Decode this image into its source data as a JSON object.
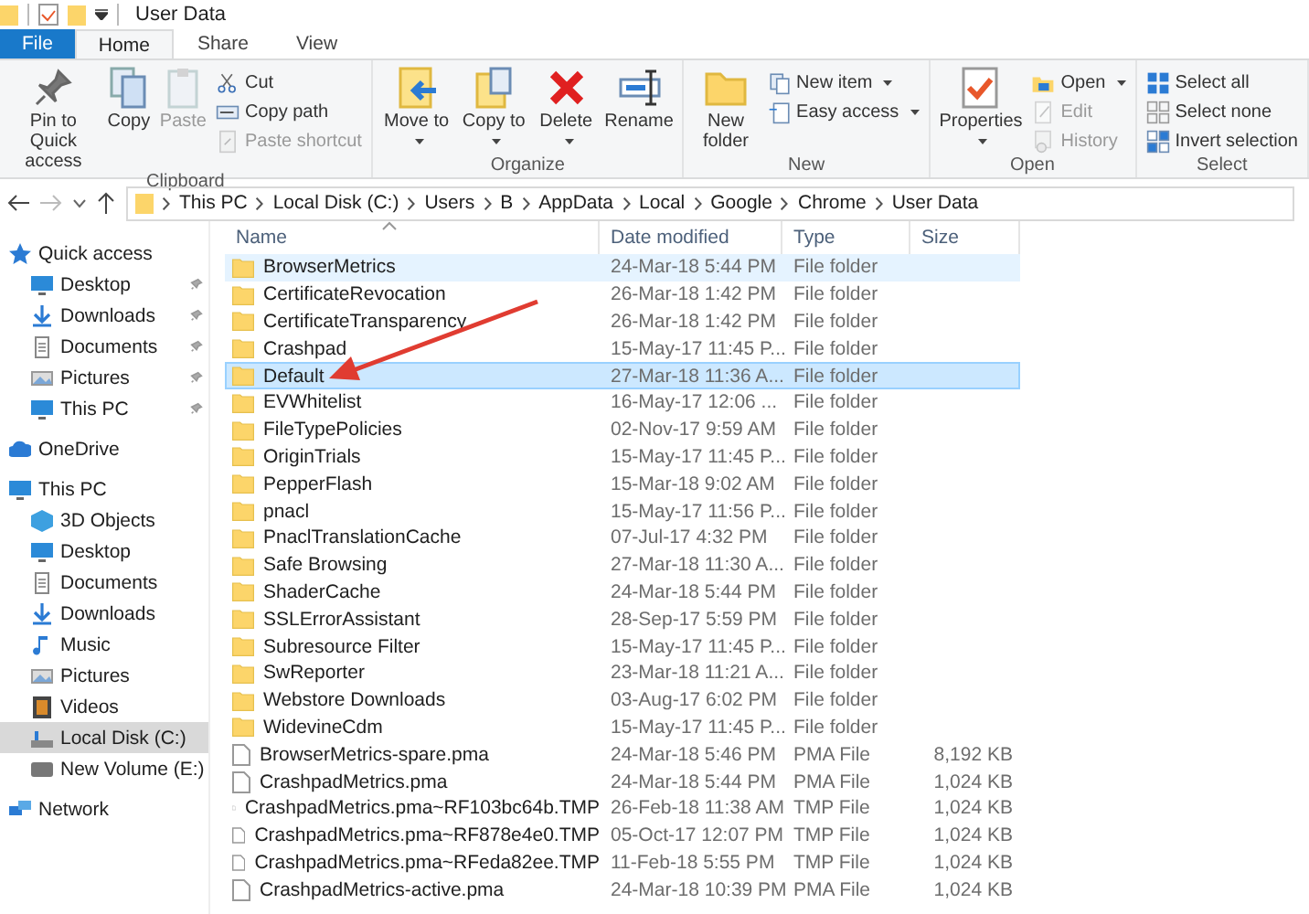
{
  "window": {
    "title": "User Data"
  },
  "tabs": [
    {
      "label": "File",
      "kind": "file",
      "selected": false
    },
    {
      "label": "Home",
      "kind": "tab",
      "selected": true
    },
    {
      "label": "Share",
      "kind": "tab",
      "selected": false
    },
    {
      "label": "View",
      "kind": "tab",
      "selected": false
    }
  ],
  "ribbon": [
    {
      "name": "Clipboard",
      "large": [
        {
          "label": "Pin to Quick access",
          "kind": "pin",
          "disabled": false,
          "dropdown": false
        },
        {
          "label": "Copy",
          "kind": "copy",
          "disabled": false,
          "dropdown": false
        },
        {
          "label": "Paste",
          "kind": "paste",
          "disabled": true,
          "dropdown": false
        }
      ],
      "small": [
        {
          "label": "Cut",
          "kind": "cut",
          "disabled": false,
          "dropdown": false
        },
        {
          "label": "Copy path",
          "kind": "path",
          "disabled": false,
          "dropdown": false
        },
        {
          "label": "Paste shortcut",
          "kind": "shortcut",
          "disabled": true,
          "dropdown": false
        }
      ]
    },
    {
      "name": "Organize",
      "large": [
        {
          "label": "Move to",
          "kind": "move",
          "disabled": false,
          "dropdown": true
        },
        {
          "label": "Copy to",
          "kind": "copyto",
          "disabled": false,
          "dropdown": true
        },
        {
          "label": "Delete",
          "kind": "delete",
          "disabled": false,
          "dropdown": true
        },
        {
          "label": "Rename",
          "kind": "rename",
          "disabled": false,
          "dropdown": false
        }
      ]
    },
    {
      "name": "New",
      "large": [
        {
          "label": "New folder",
          "kind": "folder",
          "disabled": false,
          "dropdown": false
        }
      ],
      "small": [
        {
          "label": "New item",
          "kind": "newitem",
          "disabled": false,
          "dropdown": true
        },
        {
          "label": "Easy access",
          "kind": "easy",
          "disabled": false,
          "dropdown": true
        }
      ]
    },
    {
      "name": "Open",
      "large": [
        {
          "label": "Properties",
          "kind": "props",
          "disabled": false,
          "dropdown": true
        }
      ],
      "small": [
        {
          "label": "Open",
          "kind": "open",
          "disabled": false,
          "dropdown": true
        },
        {
          "label": "Edit",
          "kind": "edit",
          "disabled": true,
          "dropdown": false
        },
        {
          "label": "History",
          "kind": "history",
          "disabled": true,
          "dropdown": false
        }
      ]
    },
    {
      "name": "Select",
      "small": [
        {
          "label": "Select all",
          "kind": "selall",
          "disabled": false,
          "dropdown": false
        },
        {
          "label": "Select none",
          "kind": "selnone",
          "disabled": false,
          "dropdown": false
        },
        {
          "label": "Invert selection",
          "kind": "invert",
          "disabled": false,
          "dropdown": false
        }
      ]
    }
  ],
  "address": {
    "path": [
      "This PC",
      "Local Disk (C:)",
      "Users",
      "B",
      "AppData",
      "Local",
      "Google",
      "Chrome",
      "User Data"
    ]
  },
  "sidebar": {
    "items": [
      {
        "label": "Quick access",
        "kind": "star",
        "selected": false,
        "children": [
          {
            "label": "Desktop",
            "kind": "desktop",
            "pinned": true,
            "selected": false
          },
          {
            "label": "Downloads",
            "kind": "download",
            "pinned": true,
            "selected": false
          },
          {
            "label": "Documents",
            "kind": "document",
            "pinned": true,
            "selected": false
          },
          {
            "label": "Pictures",
            "kind": "picture",
            "pinned": true,
            "selected": false
          },
          {
            "label": "This PC",
            "kind": "desktop",
            "pinned": true,
            "selected": false
          }
        ]
      },
      {
        "label": "OneDrive",
        "kind": "cloud",
        "selected": false
      },
      {
        "label": "This PC",
        "kind": "desktop",
        "selected": false,
        "children": [
          {
            "label": "3D Objects",
            "kind": "cube",
            "pinned": false,
            "selected": false
          },
          {
            "label": "Desktop",
            "kind": "desktop",
            "pinned": false,
            "selected": false
          },
          {
            "label": "Documents",
            "kind": "document",
            "pinned": false,
            "selected": false
          },
          {
            "label": "Downloads",
            "kind": "download",
            "pinned": false,
            "selected": false
          },
          {
            "label": "Music",
            "kind": "music",
            "pinned": false,
            "selected": false
          },
          {
            "label": "Pictures",
            "kind": "picture",
            "pinned": false,
            "selected": false
          },
          {
            "label": "Videos",
            "kind": "video",
            "pinned": false,
            "selected": false
          },
          {
            "label": "Local Disk (C:)",
            "kind": "disk",
            "pinned": false,
            "selected": true
          },
          {
            "label": "New Volume (E:)",
            "kind": "drive",
            "pinned": false,
            "selected": false
          }
        ]
      },
      {
        "label": "Network",
        "kind": "network",
        "selected": false
      }
    ]
  },
  "table": {
    "columns": [
      "Name",
      "Date modified",
      "Type",
      "Size"
    ],
    "rows": [
      {
        "kind": "folder",
        "name": "BrowserMetrics",
        "date": "24-Mar-18 5:44 PM",
        "type": "File folder",
        "hovered": true,
        "selected": false
      },
      {
        "kind": "folder",
        "name": "CertificateRevocation",
        "date": "26-Mar-18 1:42 PM",
        "type": "File folder",
        "hovered": false,
        "selected": false
      },
      {
        "kind": "folder",
        "name": "CertificateTransparency",
        "date": "26-Mar-18 1:42 PM",
        "type": "File folder",
        "hovered": false,
        "selected": false
      },
      {
        "kind": "folder",
        "name": "Crashpad",
        "date": "15-May-17 11:45 P...",
        "type": "File folder",
        "hovered": false,
        "selected": false
      },
      {
        "kind": "folder",
        "name": "Default",
        "date": "27-Mar-18 11:36 A...",
        "type": "File folder",
        "hovered": false,
        "selected": true
      },
      {
        "kind": "folder",
        "name": "EVWhitelist",
        "date": "16-May-17 12:06 ...",
        "type": "File folder",
        "hovered": false,
        "selected": false
      },
      {
        "kind": "folder",
        "name": "FileTypePolicies",
        "date": "02-Nov-17 9:59 AM",
        "type": "File folder",
        "hovered": false,
        "selected": false
      },
      {
        "kind": "folder",
        "name": "OriginTrials",
        "date": "15-May-17 11:45 P...",
        "type": "File folder",
        "hovered": false,
        "selected": false
      },
      {
        "kind": "folder",
        "name": "PepperFlash",
        "date": "15-Mar-18 9:02 AM",
        "type": "File folder",
        "hovered": false,
        "selected": false
      },
      {
        "kind": "folder",
        "name": "pnacl",
        "date": "15-May-17 11:56 P...",
        "type": "File folder",
        "hovered": false,
        "selected": false
      },
      {
        "kind": "folder",
        "name": "PnaclTranslationCache",
        "date": "07-Jul-17 4:32 PM",
        "type": "File folder",
        "hovered": false,
        "selected": false
      },
      {
        "kind": "folder",
        "name": "Safe Browsing",
        "date": "27-Mar-18 11:30 A...",
        "type": "File folder",
        "hovered": false,
        "selected": false
      },
      {
        "kind": "folder",
        "name": "ShaderCache",
        "date": "24-Mar-18 5:44 PM",
        "type": "File folder",
        "hovered": false,
        "selected": false
      },
      {
        "kind": "folder",
        "name": "SSLErrorAssistant",
        "date": "28-Sep-17 5:59 PM",
        "type": "File folder",
        "hovered": false,
        "selected": false
      },
      {
        "kind": "folder",
        "name": "Subresource Filter",
        "date": "15-May-17 11:45 P...",
        "type": "File folder",
        "hovered": false,
        "selected": false
      },
      {
        "kind": "folder",
        "name": "SwReporter",
        "date": "23-Mar-18 11:21 A...",
        "type": "File folder",
        "hovered": false,
        "selected": false
      },
      {
        "kind": "folder",
        "name": "Webstore Downloads",
        "date": "03-Aug-17 6:02 PM",
        "type": "File folder",
        "hovered": false,
        "selected": false
      },
      {
        "kind": "folder",
        "name": "WidevineCdm",
        "date": "15-May-17 11:45 P...",
        "type": "File folder",
        "hovered": false,
        "selected": false
      },
      {
        "kind": "file",
        "name": "BrowserMetrics-spare.pma",
        "date": "24-Mar-18 5:46 PM",
        "type": "PMA File",
        "size": "8,192 KB",
        "hovered": false,
        "selected": false
      },
      {
        "kind": "file",
        "name": "CrashpadMetrics.pma",
        "date": "24-Mar-18 5:44 PM",
        "type": "PMA File",
        "size": "1,024 KB",
        "hovered": false,
        "selected": false
      },
      {
        "kind": "file",
        "name": "CrashpadMetrics.pma~RF103bc64b.TMP",
        "date": "26-Feb-18 11:38 AM",
        "type": "TMP File",
        "size": "1,024 KB",
        "hovered": false,
        "selected": false
      },
      {
        "kind": "file",
        "name": "CrashpadMetrics.pma~RF878e4e0.TMP",
        "date": "05-Oct-17 12:07 PM",
        "type": "TMP File",
        "size": "1,024 KB",
        "hovered": false,
        "selected": false
      },
      {
        "kind": "file",
        "name": "CrashpadMetrics.pma~RFeda82ee.TMP",
        "date": "11-Feb-18 5:55 PM",
        "type": "TMP File",
        "size": "1,024 KB",
        "hovered": false,
        "selected": false
      },
      {
        "kind": "file",
        "name": "CrashpadMetrics-active.pma",
        "date": "24-Mar-18 10:39 PM",
        "type": "PMA File",
        "size": "1,024 KB",
        "hovered": false,
        "selected": false
      }
    ]
  },
  "annotation": {
    "kind": "arrow"
  }
}
